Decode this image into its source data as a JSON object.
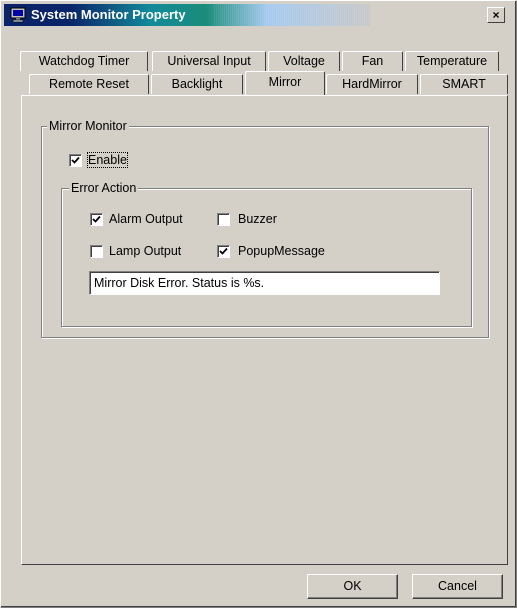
{
  "window": {
    "title": "System Monitor Property",
    "close_glyph": "×"
  },
  "tabs": {
    "back_row": [
      "Watchdog Timer",
      "Universal Input",
      "Voltage",
      "Fan",
      "Temperature"
    ],
    "front_row": [
      "Remote Reset",
      "Backlight",
      "Mirror",
      "HardMirror",
      "SMART"
    ],
    "active": "Mirror"
  },
  "mirror_monitor": {
    "group_label": "Mirror Monitor",
    "enable": {
      "label": "Enable",
      "checked": true
    },
    "error_action": {
      "group_label": "Error Action",
      "alarm_output": {
        "label": "Alarm Output",
        "checked": true
      },
      "buzzer": {
        "label": "Buzzer",
        "checked": false
      },
      "lamp_output": {
        "label": "Lamp Output",
        "checked": false
      },
      "popup_message": {
        "label": "PopupMessage",
        "checked": true
      },
      "message_text": "Mirror Disk Error. Status is %s."
    }
  },
  "buttons": {
    "ok": "OK",
    "cancel": "Cancel"
  },
  "icons": {
    "app": "computer-monitor-icon",
    "check": "checkmark-icon"
  }
}
